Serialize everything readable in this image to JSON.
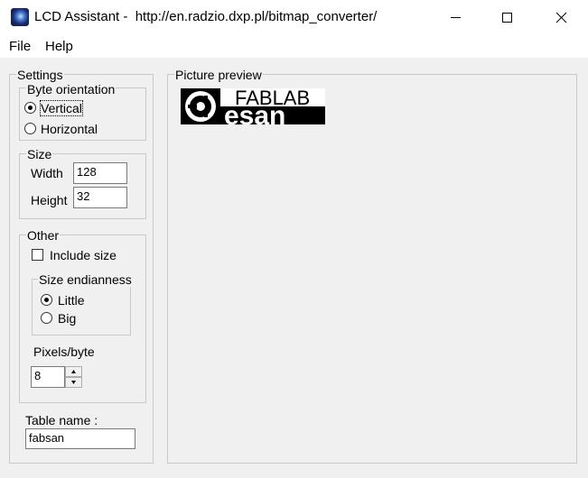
{
  "window": {
    "title": "LCD Assistant -  http://en.radzio.dxp.pl/bitmap_converter/",
    "icon": "monitor-eye-icon",
    "controls": [
      "minimize-icon",
      "maximize-icon",
      "close-icon"
    ]
  },
  "menu": {
    "items": [
      "File",
      "Help"
    ]
  },
  "settings": {
    "legend": "Settings",
    "byte_orientation": {
      "legend": "Byte orientation",
      "options": [
        "Vertical",
        "Horizontal"
      ],
      "selected": "Vertical"
    },
    "size": {
      "legend": "Size",
      "width_label": "Width",
      "width_value": "128",
      "height_label": "Height",
      "height_value": "32"
    },
    "other": {
      "legend": "Other",
      "include_size_label": "Include size",
      "include_size_checked": false,
      "size_endianness": {
        "legend": "Size endianness",
        "options": [
          "Little",
          "Big"
        ],
        "selected": "Little"
      },
      "pixels_per_byte_label": "Pixels/byte",
      "pixels_per_byte_value": "8"
    },
    "table_name_label": "Table name :",
    "table_name_value": "fabsan"
  },
  "preview": {
    "legend": "Picture preview",
    "logo_text_top": "FABLAB",
    "logo_text_bottom": "esan"
  }
}
